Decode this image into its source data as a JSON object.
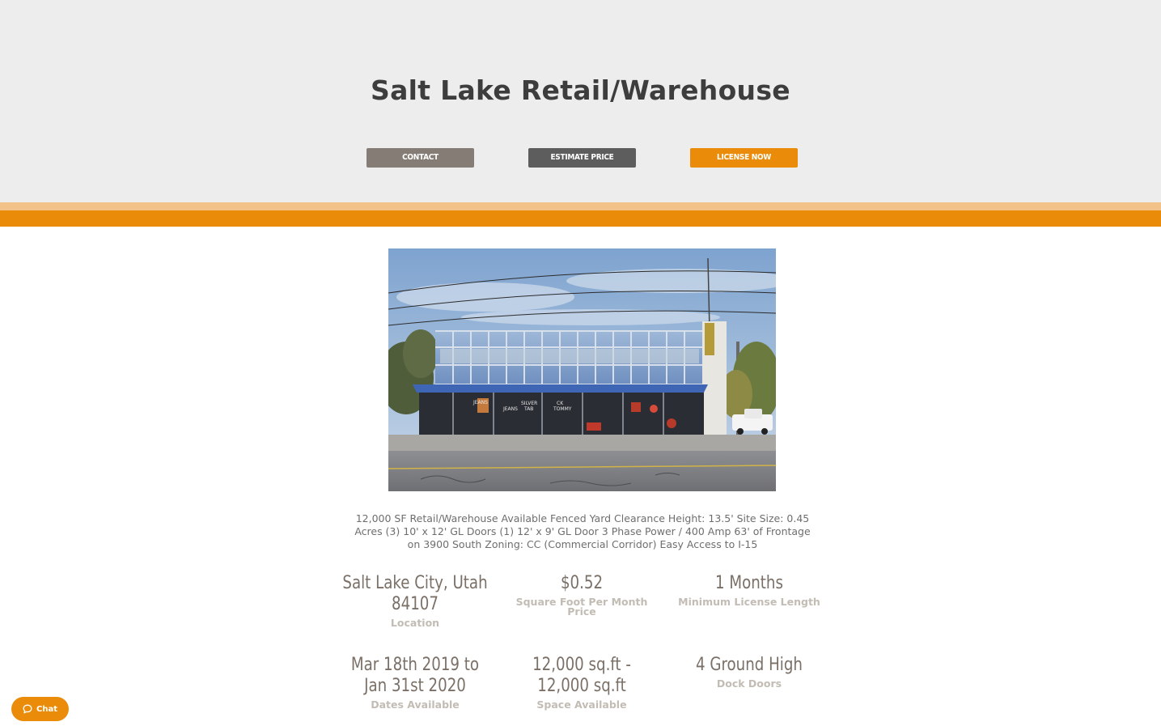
{
  "header": {
    "title": "Salt Lake Retail/Warehouse",
    "buttons": {
      "contact": "CONTACT",
      "estimate": "ESTIMATE PRICE",
      "license": "LICENSE NOW"
    }
  },
  "photo": {
    "storefront_signs": [
      "JEANS",
      "JEANS",
      "SILVER",
      "TAB",
      "CK",
      "TOMMY"
    ]
  },
  "description": "12,000 SF Retail/Warehouse Available Fenced Yard Clearance Height: 13.5' Site Size: 0.45 Acres (3) 10' x 12' GL Doors (1) 12' x 9' GL Door 3 Phase Power / 400 Amp 63' of Frontage on 3900 South Zoning: CC (Commercial Corridor) Easy Access to I-15",
  "stats": [
    {
      "value": "Salt Lake City, Utah 84107",
      "label": "Location"
    },
    {
      "value": "$0.52",
      "label": "Square Foot Per Month Price"
    },
    {
      "value": "1 Months",
      "label": "Minimum License Length"
    },
    {
      "value": "Mar 18th 2019 to Jan 31st 2020",
      "label": "Dates Available"
    },
    {
      "value": "12,000 sq.ft - 12,000 sq.ft",
      "label": "Space Available"
    },
    {
      "value": "4 Ground High",
      "label": "Dock Doors"
    }
  ],
  "chat": {
    "label": "Chat",
    "icon": "chat-bubble-icon"
  },
  "colors": {
    "hero_bg": "#ededed",
    "accent_orange": "#ea8c0a",
    "accent_light": "#f2c289",
    "contact_btn": "#857d75",
    "estimate_btn": "#5d5d5d",
    "stat_value": "#7a7067",
    "stat_label": "#c2bcb4"
  }
}
